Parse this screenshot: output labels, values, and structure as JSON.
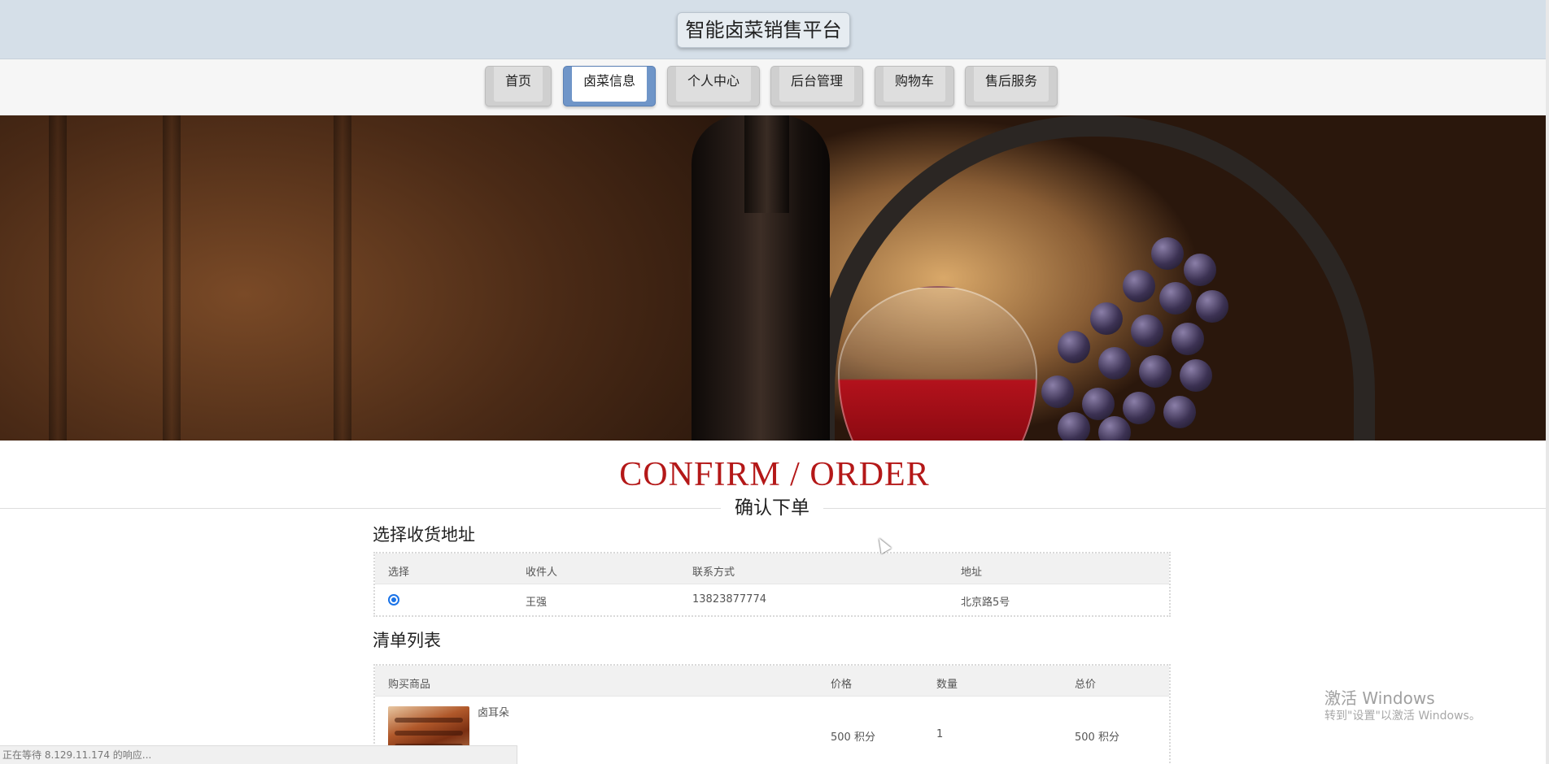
{
  "header": {
    "title": "智能卤菜销售平台"
  },
  "nav": {
    "items": [
      {
        "label": "首页"
      },
      {
        "label": "卤菜信息"
      },
      {
        "label": "个人中心"
      },
      {
        "label": "后台管理"
      },
      {
        "label": "购物车"
      },
      {
        "label": "售后服务"
      }
    ],
    "active_index": 1
  },
  "page": {
    "title_en": "CONFIRM / ORDER",
    "title_cn": "确认下单"
  },
  "address_section": {
    "heading": "选择收货地址",
    "columns": [
      "选择",
      "收件人",
      "联系方式",
      "地址"
    ],
    "rows": [
      {
        "selected": true,
        "recipient": "王强",
        "phone": "13823877774",
        "address": "北京路5号"
      }
    ]
  },
  "order_section": {
    "heading": "清单列表",
    "columns": [
      "购买商品",
      "价格",
      "数量",
      "总价"
    ],
    "rows": [
      {
        "name": "卤耳朵",
        "price": "500 积分",
        "qty": "1",
        "total": "500 积分"
      }
    ]
  },
  "watermark": {
    "line1": "激活 Windows",
    "line2": "转到\"设置\"以激活 Windows。"
  },
  "status_bar": {
    "text": "正在等待 8.129.11.174 的响应..."
  },
  "colors": {
    "accent_title": "#b41818",
    "header_bg": "#d5dfe8",
    "nav_active": "#6f95c8"
  }
}
